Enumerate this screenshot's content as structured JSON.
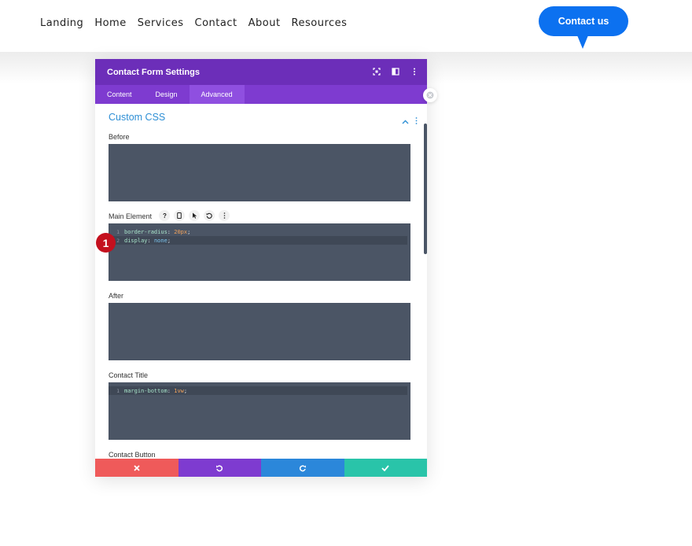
{
  "nav": {
    "items": [
      "Landing",
      "Home",
      "Services",
      "Contact",
      "About",
      "Resources"
    ],
    "cta_label": "Contact us"
  },
  "modal": {
    "title": "Contact Form Settings",
    "tabs": [
      {
        "label": "Content",
        "active": false
      },
      {
        "label": "Design",
        "active": false
      },
      {
        "label": "Advanced",
        "active": true
      }
    ],
    "section_title": "Custom CSS",
    "fields": {
      "before": {
        "label": "Before"
      },
      "main": {
        "label": "Main Element",
        "lines": [
          {
            "num": "1",
            "prop": "border-radius",
            "value": "20px"
          },
          {
            "num": "2",
            "prop": "display",
            "value": "none"
          }
        ]
      },
      "after": {
        "label": "After"
      },
      "title": {
        "label": "Contact Title",
        "lines": [
          {
            "num": "1",
            "prop": "margin-bottom",
            "value": "1vw"
          }
        ]
      },
      "button": {
        "label": "Contact Button"
      }
    },
    "footer": {
      "colors": [
        "#ef5a5a",
        "#7e3bd0",
        "#2b87da",
        "#29c4a9"
      ]
    }
  },
  "annotation": {
    "badge": "1"
  },
  "colors": {
    "accent": "#6c2eb9",
    "cta": "#0c71f0",
    "badge": "#c4101e"
  }
}
